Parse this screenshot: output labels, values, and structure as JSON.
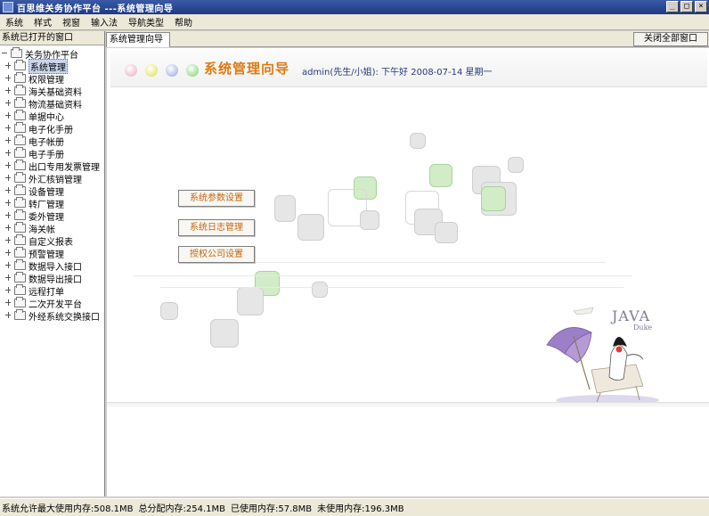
{
  "window": {
    "title": "百思维关务协作平台 ---系统管理向导",
    "controls": [
      "_",
      "□",
      "×"
    ]
  },
  "menubar": {
    "items": [
      "系统",
      "样式",
      "视窗",
      "输入法",
      "导航类型",
      "帮助"
    ]
  },
  "sidebar": {
    "header": "系统已打开的窗口",
    "root": "关务协作平台",
    "items": [
      "系统管理",
      "权限管理",
      "海关基础资料",
      "物流基础资料",
      "单据中心",
      "电子化手册",
      "电子帐册",
      "电子手册",
      "出口专用发票管理",
      "外汇核销管理",
      "设备管理",
      "转厂管理",
      "委外管理",
      "海关帐",
      "自定义报表",
      "预警管理",
      "数据导入接口",
      "数据导出接口",
      "远程打单",
      "二次开发平台",
      "外经系统交换接口"
    ],
    "selected_index": 0
  },
  "tabs": {
    "active_label": "系统管理向导",
    "close_glyph": "X",
    "close_all_label": "关闭全部窗口"
  },
  "banner": {
    "title": "系统管理向导",
    "status": "admin(先生/小姐): 下午好 2008-07-14 星期一"
  },
  "nav_buttons": {
    "system_params": "系统参数设置",
    "system_log": "系统日志管理",
    "authorized_company": "授权公司设置"
  },
  "java_logo": {
    "word": "JAVA",
    "sub": "Duke"
  },
  "status_bar": {
    "max_memory": "系统允许最大使用内存:508.1MB",
    "total_allocated": "总分配内存:254.1MB",
    "used": "已使用内存:57.8MB",
    "unused": "未使用内存:196.3MB"
  },
  "colors": {
    "title_orange": "#e07a14",
    "button_text": "#c8640a",
    "status_blue": "#223c7a",
    "titlebar": "#1e3a82"
  }
}
